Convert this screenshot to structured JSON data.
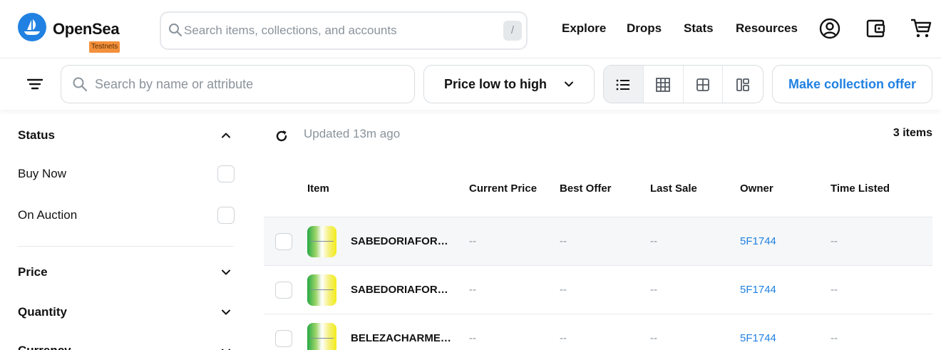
{
  "brand": {
    "name": "OpenSea",
    "badge": "Testnets",
    "accent": "#2081e2",
    "badge_color": "#f3903c"
  },
  "top_search": {
    "placeholder": "Search items, collections, and accounts",
    "shortcut": "/"
  },
  "nav": {
    "links": [
      "Explore",
      "Drops",
      "Stats",
      "Resources"
    ],
    "icons": [
      "account-icon",
      "wallet-icon",
      "cart-icon"
    ]
  },
  "toolbar": {
    "filter_icon": "filter-icon",
    "search_placeholder": "Search by name or attribute",
    "sort_value": "Price low to high",
    "view_modes": [
      "list-view-icon",
      "grid-large-icon",
      "grid-small-icon",
      "split-view-icon"
    ],
    "active_view": "list-view-icon",
    "offer_label": "Make collection offer"
  },
  "sidebar": {
    "status": {
      "title": "Status",
      "options": [
        "Buy Now",
        "On Auction"
      ],
      "expanded": true
    },
    "price": {
      "title": "Price"
    },
    "quantity": {
      "title": "Quantity"
    },
    "currency": {
      "title": "Currency"
    }
  },
  "main": {
    "updated": "Updated 13m ago",
    "count": "3 items",
    "columns": [
      "Item",
      "Current Price",
      "Best Offer",
      "Last Sale",
      "Owner",
      "Time Listed"
    ],
    "rows": [
      {
        "name": "SABEDORIAFORCAMENTE",
        "price": "--",
        "best_offer": "--",
        "last_sale": "--",
        "owner": "5F1744",
        "time_listed": "--"
      },
      {
        "name": "SABEDORIAFORCAINTELIGENCIA",
        "price": "--",
        "best_offer": "--",
        "last_sale": "--",
        "owner": "5F1744",
        "time_listed": "--"
      },
      {
        "name": "BELEZACHARMESIMPATIA",
        "price": "--",
        "best_offer": "--",
        "last_sale": "--",
        "owner": "5F1744",
        "time_listed": "--"
      }
    ]
  }
}
